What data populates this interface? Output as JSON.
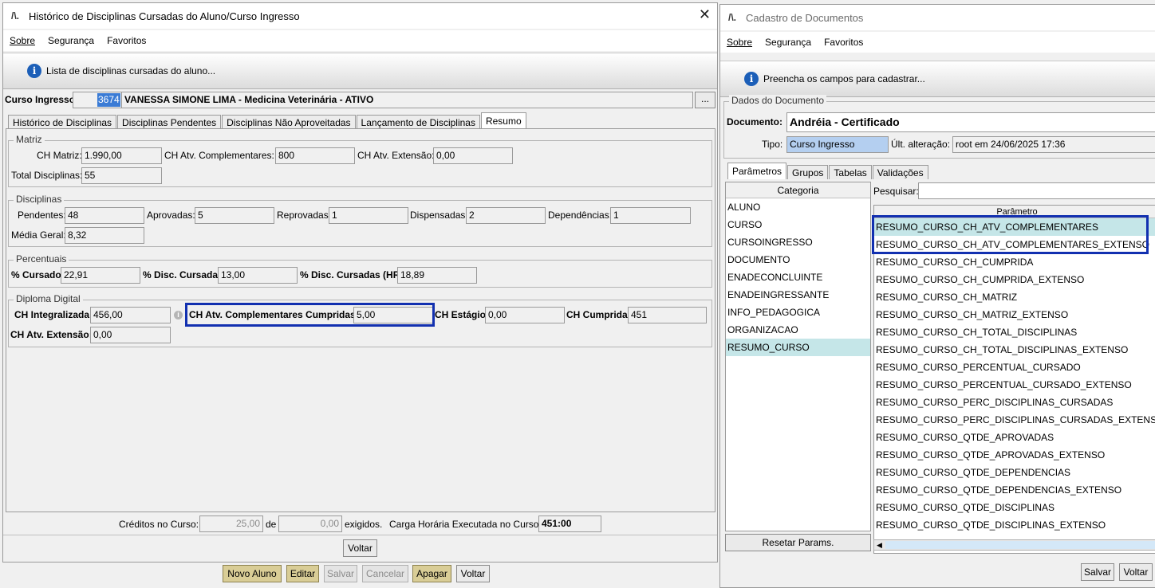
{
  "left_window": {
    "title": "Histórico de Disciplinas Cursadas do Aluno/Curso Ingresso",
    "menu": [
      "Sobre",
      "Segurança",
      "Favoritos"
    ],
    "info_text": "Lista de disciplinas cursadas do aluno...",
    "curso_ingresso_label": "Curso Ingresso:",
    "curso_ingresso_code": "3674",
    "curso_ingresso_name": "VANESSA SIMONE LIMA - Medicina Veterinária - ATIVO",
    "ellipsis": "...",
    "tabs": [
      "Histórico de Disciplinas",
      "Disciplinas Pendentes",
      "Disciplinas Não Aproveitadas",
      "Lançamento de Disciplinas",
      "Resumo"
    ],
    "matriz": {
      "title": "Matriz",
      "ch_matriz_label": "CH Matriz:",
      "ch_matriz": "1.990,00",
      "ch_atv_comp_label": "CH Atv. Complementares:",
      "ch_atv_comp": "800",
      "ch_atv_ext_label": "CH Atv. Extensão:",
      "ch_atv_ext": "0,00",
      "total_label": "Total Disciplinas:",
      "total": "55"
    },
    "disciplinas": {
      "title": "Disciplinas",
      "pendentes_label": "Pendentes:",
      "pendentes": "48",
      "aprovadas_label": "Aprovadas:",
      "aprovadas": "5",
      "reprovadas_label": "Reprovadas:",
      "reprovadas": "1",
      "dispensadas_label": "Dispensadas:",
      "dispensadas": "2",
      "dependencias_label": "Dependências:",
      "dependencias": "1",
      "media_label": "Média Geral:",
      "media": "8,32"
    },
    "percentuais": {
      "title": "Percentuais",
      "cursado_label": "% Cursado:",
      "cursado": "22,91",
      "disc_label": "% Disc. Cursadas:",
      "disc": "13,00",
      "disc_hr_label": "% Disc. Cursadas (HR):",
      "disc_hr": "18,89"
    },
    "diploma": {
      "title": "Diploma Digital",
      "ch_integ_label": "CH Integralizada:",
      "ch_integ": "456,00",
      "ch_atv_comp_cumpr_label": "CH Atv. Complementares Cumpridas:",
      "ch_atv_comp_cumpr": "5,00",
      "ch_estagio_label": "CH Estágio:",
      "ch_estagio": "0,00",
      "ch_cumprida_label": "CH Cumprida:",
      "ch_cumprida": "451",
      "ch_atv_ext_label": "CH Atv. Extensão:",
      "ch_atv_ext": "0,00"
    },
    "footer": {
      "creditos_label": "Créditos no Curso:",
      "creditos": "25,00",
      "de": "de",
      "exigidos_value": "0,00",
      "exigidos": "exigidos.",
      "carga_label": "Carga Horária Executada no Curso:",
      "carga": "451:00"
    },
    "voltar": "Voltar"
  },
  "bottom_buttons": [
    "Novo Aluno",
    "Editar",
    "Salvar",
    "Cancelar",
    "Apagar",
    "Voltar"
  ],
  "right_window": {
    "title": "Cadastro de Documentos",
    "menu": [
      "Sobre",
      "Segurança",
      "Favoritos"
    ],
    "info_text": "Preencha os campos para cadastrar...",
    "dados_title": "Dados do Documento",
    "documento_label": "Documento:",
    "documento": "Andréia - Certificado",
    "tipo_label": "Tipo:",
    "tipo": "Curso Ingresso",
    "ult_alt_label": "Últ. alteração:",
    "ult_alt": "root em 24/06/2025 17:36",
    "tabs": [
      "Parâmetros",
      "Grupos",
      "Tabelas",
      "Validações"
    ],
    "categoria_header": "Categoria",
    "categorias": [
      "ALUNO",
      "CURSO",
      "CURSOINGRESSO",
      "DOCUMENTO",
      "ENADECONCLUINTE",
      "ENADEINGRESSANTE",
      "INFO_PEDAGOGICA",
      "ORGANIZACAO",
      "RESUMO_CURSO"
    ],
    "pesquisar_label": "Pesquisar:",
    "parametro_header": "Parâmetro",
    "parametros": [
      "RESUMO_CURSO_CH_ATV_COMPLEMENTARES",
      "RESUMO_CURSO_CH_ATV_COMPLEMENTARES_EXTENSO",
      "RESUMO_CURSO_CH_CUMPRIDA",
      "RESUMO_CURSO_CH_CUMPRIDA_EXTENSO",
      "RESUMO_CURSO_CH_MATRIZ",
      "RESUMO_CURSO_CH_MATRIZ_EXTENSO",
      "RESUMO_CURSO_CH_TOTAL_DISCIPLINAS",
      "RESUMO_CURSO_CH_TOTAL_DISCIPLINAS_EXTENSO",
      "RESUMO_CURSO_PERCENTUAL_CURSADO",
      "RESUMO_CURSO_PERCENTUAL_CURSADO_EXTENSO",
      "RESUMO_CURSO_PERC_DISCIPLINAS_CURSADAS",
      "RESUMO_CURSO_PERC_DISCIPLINAS_CURSADAS_EXTENSO",
      "RESUMO_CURSO_QTDE_APROVADAS",
      "RESUMO_CURSO_QTDE_APROVADAS_EXTENSO",
      "RESUMO_CURSO_QTDE_DEPENDENCIAS",
      "RESUMO_CURSO_QTDE_DEPENDENCIAS_EXTENSO",
      "RESUMO_CURSO_QTDE_DISCIPLINAS",
      "RESUMO_CURSO_QTDE_DISCIPLINAS_EXTENSO"
    ],
    "resetar": "Resetar Params.",
    "salvar": "Salvar",
    "voltar": "Voltar"
  },
  "colors": {
    "highlight_border": "#1230b0",
    "selection": "#c5e6e8",
    "gold_button": "#d9cd96",
    "info_icon": "#1c5fb8",
    "code_selected": "#3a7bd5"
  }
}
